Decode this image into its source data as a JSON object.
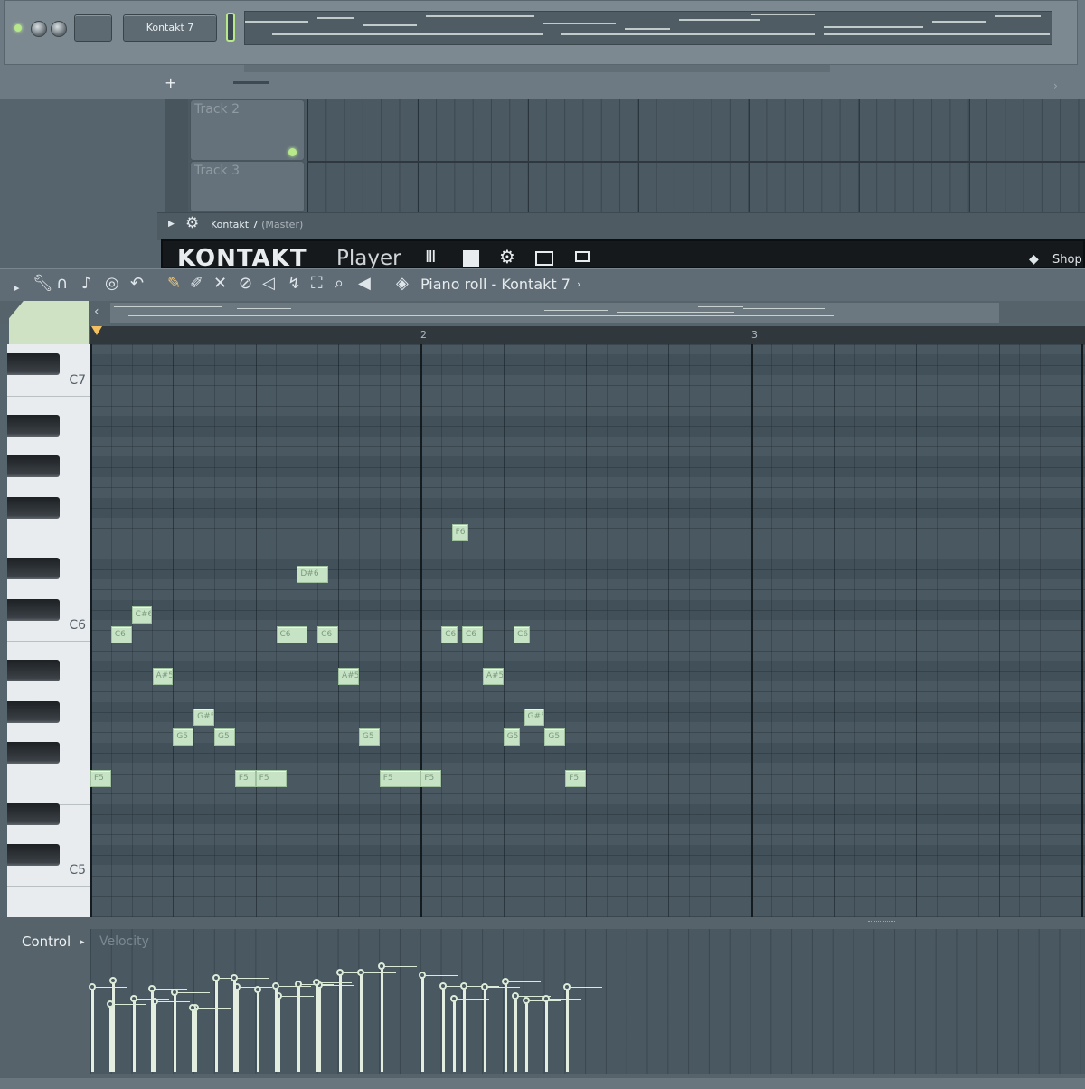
{
  "channel_rack": {
    "channel_name": "Kontakt 7",
    "add_label": "+"
  },
  "playlist": {
    "tracks": [
      {
        "name": "Track 2"
      },
      {
        "name": "Track 3"
      }
    ]
  },
  "mixer_row": {
    "plugin_title": "Kontakt 7",
    "plugin_suffix": "(Master)"
  },
  "kontakt_player": {
    "logo_text": "KONTAKT",
    "logo_suffix": "Player",
    "shop_label": "Shop"
  },
  "piano_roll": {
    "title": "Piano roll - Kontakt 7",
    "bar_numbers": [
      "2",
      "3"
    ],
    "key_labels": [
      "C7",
      "C6",
      "C5"
    ],
    "notes": [
      {
        "label": "F5",
        "start": 0.0,
        "len": 0.5,
        "row": 21
      },
      {
        "label": "C6",
        "start": 0.5,
        "len": 0.5,
        "row": 14
      },
      {
        "label": "C#6",
        "start": 1.0,
        "len": 0.5,
        "row": 13
      },
      {
        "label": "A#5",
        "start": 1.5,
        "len": 0.5,
        "row": 16
      },
      {
        "label": "G5",
        "start": 2.0,
        "len": 0.5,
        "row": 19
      },
      {
        "label": "G#5",
        "start": 2.5,
        "len": 0.5,
        "row": 18
      },
      {
        "label": "G5",
        "start": 3.0,
        "len": 0.5,
        "row": 19
      },
      {
        "label": "F5",
        "start": 3.5,
        "len": 0.5,
        "row": 21
      },
      {
        "label": "F5",
        "start": 4.0,
        "len": 0.75,
        "row": 21
      },
      {
        "label": "C6",
        "start": 4.5,
        "len": 0.75,
        "row": 14
      },
      {
        "label": "D#6",
        "start": 5.0,
        "len": 0.75,
        "row": 11
      },
      {
        "label": "C6",
        "start": 5.5,
        "len": 0.5,
        "row": 14
      },
      {
        "label": "A#5",
        "start": 6.0,
        "len": 0.5,
        "row": 16
      },
      {
        "label": "G5",
        "start": 6.5,
        "len": 0.5,
        "row": 19
      },
      {
        "label": "F5",
        "start": 7.0,
        "len": 1.0,
        "row": 21
      },
      {
        "label": "F5",
        "start": 8.0,
        "len": 0.5,
        "row": 21
      },
      {
        "label": "C6",
        "start": 8.5,
        "len": 0.25,
        "row": 14
      },
      {
        "label": "F6",
        "start": 8.75,
        "len": 0.25,
        "row": 9
      },
      {
        "label": "C6",
        "start": 9.0,
        "len": 0.5,
        "row": 14
      },
      {
        "label": "A#5",
        "start": 9.5,
        "len": 0.5,
        "row": 16
      },
      {
        "label": "G5",
        "start": 10.0,
        "len": 0.25,
        "row": 19
      },
      {
        "label": "C6",
        "start": 10.25,
        "len": 0.25,
        "row": 14
      },
      {
        "label": "G#5",
        "start": 10.5,
        "len": 0.5,
        "row": 18
      },
      {
        "label": "G5",
        "start": 11.0,
        "len": 0.5,
        "row": 19
      },
      {
        "label": "F5",
        "start": 11.5,
        "len": 0.5,
        "row": 21
      }
    ]
  },
  "event_editor": {
    "control_label": "Control",
    "target_label": "Velocity",
    "velocities": [
      0.72,
      0.78,
      0.62,
      0.6,
      0.68,
      0.55,
      0.8,
      0.72,
      0.7,
      0.65,
      0.75,
      0.74,
      0.85,
      0.85,
      0.9,
      0.82,
      0.73,
      0.62,
      0.73,
      0.72,
      0.77,
      0.65,
      0.61,
      0.62,
      0.72,
      0.58,
      0.71,
      0.55,
      0.8,
      0.73,
      0.76
    ]
  },
  "colors": {
    "note_fill": "#c7e3c5",
    "grid_bg": "#4a5862",
    "accent_green": "#b7e88a"
  }
}
